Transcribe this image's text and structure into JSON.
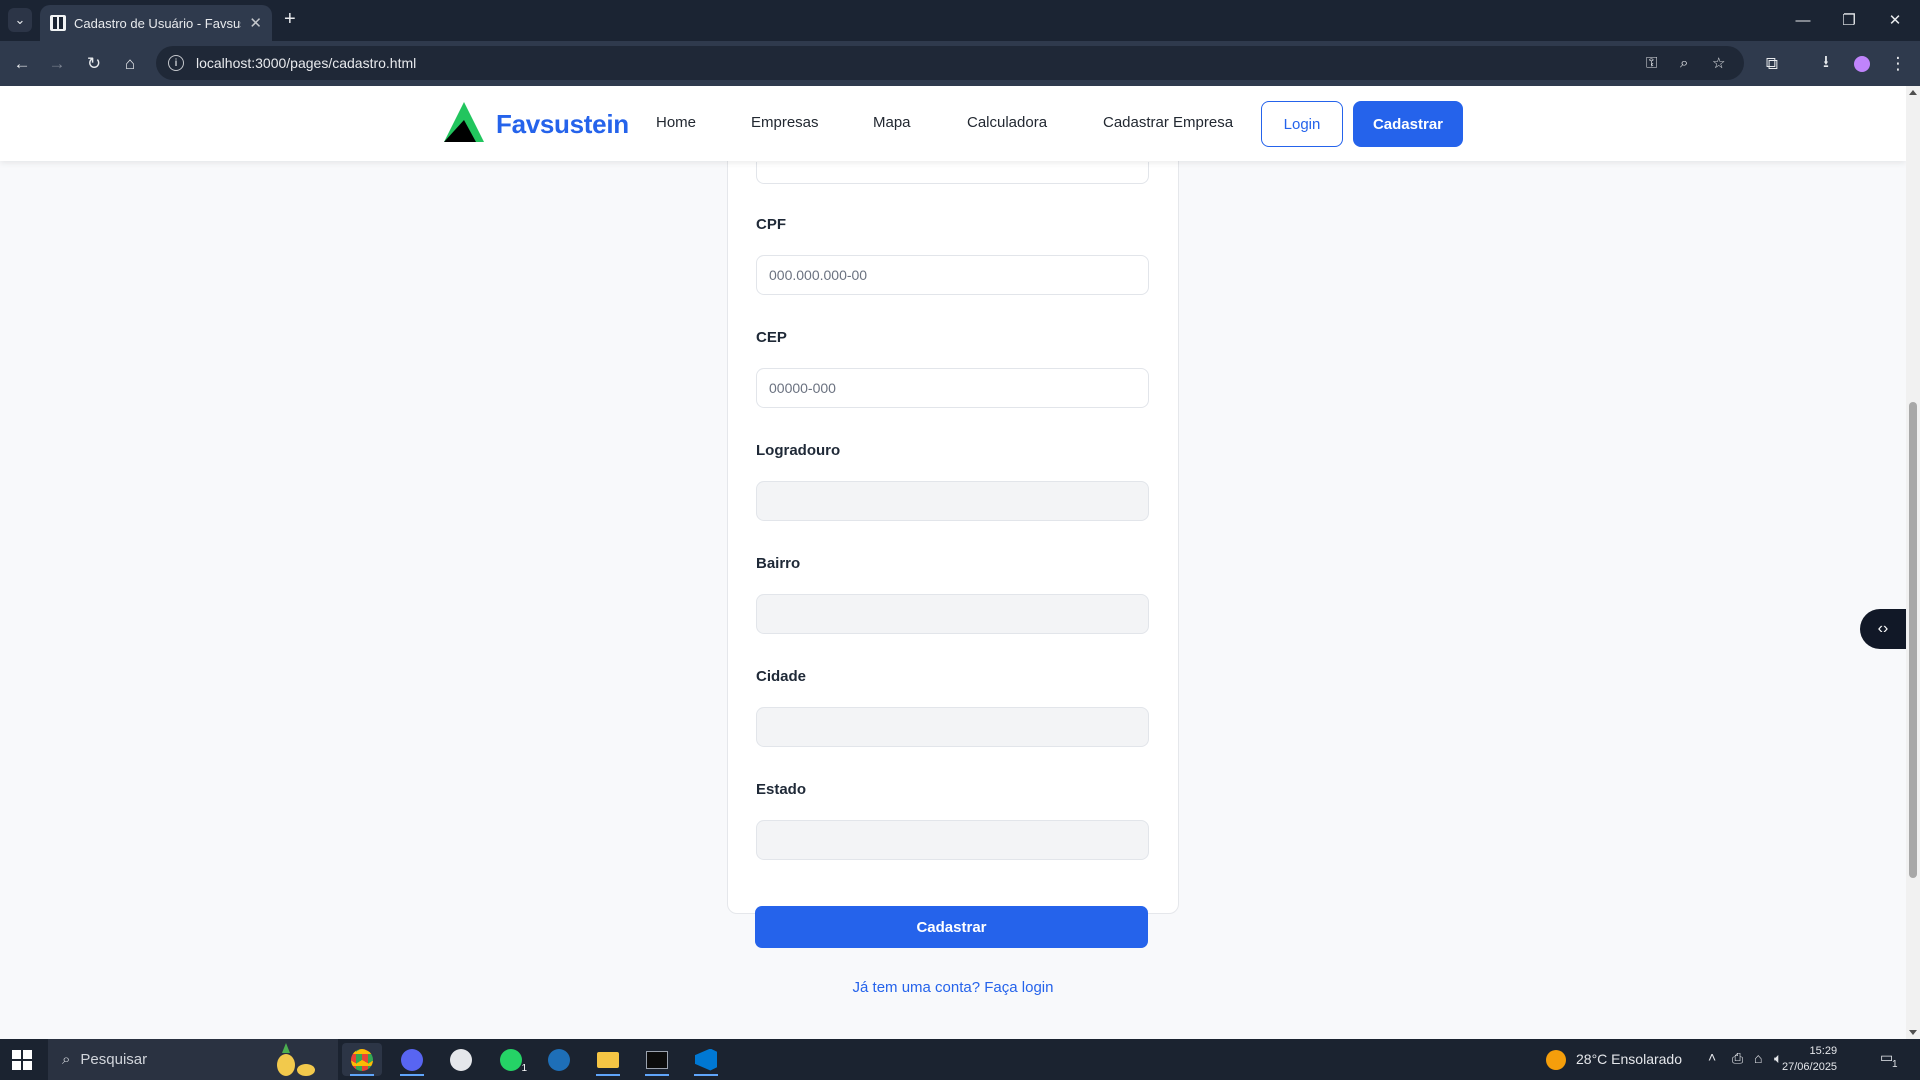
{
  "browser": {
    "tab_title": "Cadastro de Usuário - Favsustein",
    "url": "localhost:3000/pages/cadastro.html"
  },
  "site": {
    "brand": "Favsustein",
    "nav": [
      "Home",
      "Empresas",
      "Mapa",
      "Calculadora",
      "Cadastrar Empresa"
    ],
    "login_button": "Login",
    "register_button": "Cadastrar"
  },
  "form": {
    "fields": [
      {
        "label": "CPF",
        "placeholder": "000.000.000-00",
        "readonly": false
      },
      {
        "label": "CEP",
        "placeholder": "00000-000",
        "readonly": false
      },
      {
        "label": "Logradouro",
        "placeholder": "",
        "readonly": true
      },
      {
        "label": "Bairro",
        "placeholder": "",
        "readonly": true
      },
      {
        "label": "Cidade",
        "placeholder": "",
        "readonly": true
      },
      {
        "label": "Estado",
        "placeholder": "",
        "readonly": true
      }
    ],
    "submit_label": "Cadastrar",
    "login_link": "Já tem uma conta? Faça login"
  },
  "taskbar": {
    "search_placeholder": "Pesquisar",
    "weather": "28°C  Ensolarado",
    "time": "15:29",
    "date": "27/06/2025",
    "notification_count": "1",
    "whatsapp_badge": "1"
  },
  "colors": {
    "brand_blue": "#2563eb",
    "logo_green": "#22c55e",
    "logo_black": "#000000"
  }
}
